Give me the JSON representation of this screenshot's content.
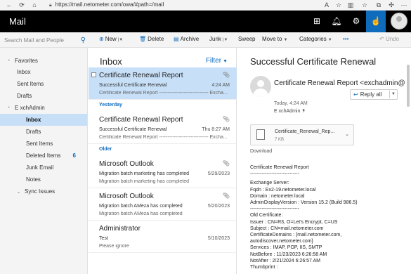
{
  "browser": {
    "url": "https://mail.netometer.com/owa/#path=/mail",
    "back_icon": "arrow-left-icon",
    "refresh_icon": "refresh-icon",
    "home_icon": "home-icon",
    "lock_icon": "lock-icon"
  },
  "header": {
    "app_title": "Mail",
    "accent": "#0f6cbd"
  },
  "toolbar": {
    "search_placeholder": "Search Mail and People",
    "new_label": "New",
    "delete_label": "Delete",
    "archive_label": "Archive",
    "junk_label": "Junk",
    "sweep_label": "Sweep",
    "move_to_label": "Move to",
    "categories_label": "Categories",
    "more_label": "•••",
    "undo_label": "Undo"
  },
  "sidebar": {
    "favorites_label": "Favorites",
    "favorites": [
      {
        "label": "Inbox"
      },
      {
        "label": "Sent Items"
      },
      {
        "label": "Drafts"
      }
    ],
    "account_label": "E xchAdmin",
    "folders": [
      {
        "label": "Inbox",
        "count": ""
      },
      {
        "label": "Drafts",
        "count": ""
      },
      {
        "label": "Sent Items",
        "count": ""
      },
      {
        "label": "Deleted Items",
        "count": "6"
      },
      {
        "label": "Junk Email",
        "count": ""
      },
      {
        "label": "Notes",
        "count": ""
      },
      {
        "label": "Sync Issues",
        "count": ""
      }
    ]
  },
  "message_list": {
    "title": "Inbox",
    "filter_label": "Filter",
    "groups": {
      "yesterday": "Yesterday",
      "older": "Older"
    },
    "messages": [
      {
        "sender": "Certificate Renewal Report",
        "subject": "Successful Certificate Renewal",
        "date": "4:24 AM",
        "preview": "Certificate Renewal Report ------------------------------ Excha..."
      },
      {
        "sender": "Certificate Renewal Report",
        "subject": "Successful Certificate Renewal",
        "date": "Thu 8:27 AM",
        "preview": "Certificate Renewal Report ------------------------------ Excha..."
      },
      {
        "sender": "Microsoft Outlook",
        "subject": "Migration batch marketing has completed",
        "date": "5/29/2023",
        "preview": "Migration batch marketing has completed"
      },
      {
        "sender": "Microsoft Outlook",
        "subject": "Migration batch AMeza has completed",
        "date": "5/20/2023",
        "preview": "Migration batch AMeza has completed"
      },
      {
        "sender": "Administrator",
        "subject": "Test",
        "date": "5/10/2023",
        "preview": "Please ignore"
      }
    ]
  },
  "reading_pane": {
    "subject": "Successful Certificate Renewal",
    "from": "Certificate Renewal Report <exchadmin@",
    "reply_all_label": "Reply all",
    "time": "Today, 4:24 AM",
    "to": "E xchAdmin ↟",
    "attachment": {
      "name": "Certificate_Renewal_Rep...",
      "size": "7 KB"
    },
    "download_label": "Download",
    "body_lines": [
      "Certificate Renewal Report",
      "------------------------------",
      "",
      "Exchange Server:",
      "Fqdn            : Ex2-19.netometer.local",
      "Domain          : netometer.local",
      "AdminDisplayVersion : Version 15.2 (Build 986.5)",
      "------------------------------",
      "Old Certificate:",
      "Issuer     : CN=R3, O=Let's Encrypt, C=US",
      "Subject    : CN=mail.netometer.com",
      "CertificateDomains : {mail.netometer.com,",
      "autodiscover.netometer.com}",
      "Services     : IMAP, POP, IIS, SMTP",
      "NotBefore    : 11/23/2023 6:26:58 AM",
      "NotAfter     : 2/21/2024 6:26:57 AM",
      "Thumbprint   :"
    ]
  }
}
